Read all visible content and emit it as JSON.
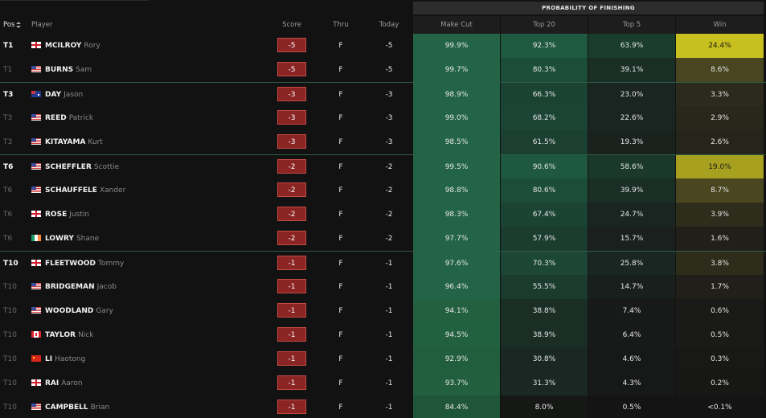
{
  "header": {
    "group_title": "PROBABILITY OF FINISHING",
    "columns": {
      "pos": "Pos",
      "player": "Player",
      "score": "Score",
      "thru": "Thru",
      "today": "Today",
      "make_cut": "Make Cut",
      "top20": "Top 20",
      "top5": "Top 5",
      "win": "Win"
    }
  },
  "colors": {
    "score_badge": "#8a2524",
    "tie_divider": "#2f5b48",
    "high_win": "#c8c01e"
  },
  "rows": [
    {
      "pos": "T1",
      "leader": true,
      "flag": "eng",
      "last": "MCILROY",
      "first": "Rory",
      "score": "-5",
      "thru": "F",
      "today": "-5",
      "make_cut": "99.9%",
      "top20": "92.3%",
      "top5": "63.9%",
      "win": "24.4%",
      "bg": [
        "#236447",
        "#1e5940",
        "#1a3d2e",
        "#c8c01e"
      ],
      "win_color": "#1a1a1a"
    },
    {
      "pos": "T1",
      "leader": false,
      "flag": "usa",
      "last": "BURNS",
      "first": "Sam",
      "score": "-5",
      "thru": "F",
      "today": "-5",
      "make_cut": "99.7%",
      "top20": "80.3%",
      "top5": "39.1%",
      "win": "8.6%",
      "bg": [
        "#236447",
        "#1c4d39",
        "#1a2e26",
        "#484520"
      ],
      "win_color": "#e6e6e6"
    },
    {
      "pos": "T3",
      "leader": true,
      "flag": "aus",
      "last": "DAY",
      "first": "Jason",
      "score": "-3",
      "thru": "F",
      "today": "-3",
      "make_cut": "98.9%",
      "top20": "66.3%",
      "top5": "23.0%",
      "win": "3.3%",
      "bg": [
        "#236447",
        "#1b4334",
        "#1a2420",
        "#2b2a1c"
      ],
      "win_color": "#e6e6e6"
    },
    {
      "pos": "T3",
      "leader": false,
      "flag": "usa",
      "last": "REED",
      "first": "Patrick",
      "score": "-3",
      "thru": "F",
      "today": "-3",
      "make_cut": "99.0%",
      "top20": "68.2%",
      "top5": "22.6%",
      "win": "2.9%",
      "bg": [
        "#236447",
        "#1b4435",
        "#1a2420",
        "#28271b"
      ],
      "win_color": "#e6e6e6"
    },
    {
      "pos": "T3",
      "leader": false,
      "flag": "usa",
      "last": "KITAYAMA",
      "first": "Kurt",
      "score": "-3",
      "thru": "F",
      "today": "-3",
      "make_cut": "98.5%",
      "top20": "61.5%",
      "top5": "19.3%",
      "win": "2.6%",
      "bg": [
        "#236447",
        "#1b3f31",
        "#1a221e",
        "#26251b"
      ],
      "win_color": "#e6e6e6"
    },
    {
      "pos": "T6",
      "leader": true,
      "flag": "usa",
      "last": "SCHEFFLER",
      "first": "Scottie",
      "score": "-2",
      "thru": "F",
      "today": "-2",
      "make_cut": "99.5%",
      "top20": "90.6%",
      "top5": "58.6%",
      "win": "19.0%",
      "bg": [
        "#236447",
        "#1e5840",
        "#1a392b",
        "#a7a11f"
      ],
      "win_color": "#1a1a1a"
    },
    {
      "pos": "T6",
      "leader": false,
      "flag": "usa",
      "last": "SCHAUFFELE",
      "first": "Xander",
      "score": "-2",
      "thru": "F",
      "today": "-2",
      "make_cut": "98.8%",
      "top20": "80.6%",
      "top5": "39.9%",
      "win": "8.7%",
      "bg": [
        "#236447",
        "#1c4d39",
        "#1a2e26",
        "#494620"
      ],
      "win_color": "#e6e6e6"
    },
    {
      "pos": "T6",
      "leader": false,
      "flag": "eng",
      "last": "ROSE",
      "first": "Justin",
      "score": "-2",
      "thru": "F",
      "today": "-2",
      "make_cut": "98.3%",
      "top20": "67.4%",
      "top5": "24.7%",
      "win": "3.9%",
      "bg": [
        "#236447",
        "#1b4334",
        "#1a2521",
        "#2e2d1c"
      ],
      "win_color": "#e6e6e6"
    },
    {
      "pos": "T6",
      "leader": false,
      "flag": "irl",
      "last": "LOWRY",
      "first": "Shane",
      "score": "-2",
      "thru": "F",
      "today": "-2",
      "make_cut": "97.7%",
      "top20": "57.9%",
      "top5": "15.7%",
      "win": "1.6%",
      "bg": [
        "#236447",
        "#1b3d30",
        "#19201d",
        "#201f19"
      ],
      "win_color": "#e6e6e6"
    },
    {
      "pos": "T10",
      "leader": true,
      "flag": "eng",
      "last": "FLEETWOOD",
      "first": "Tommy",
      "score": "-1",
      "thru": "F",
      "today": "-1",
      "make_cut": "97.6%",
      "top20": "70.3%",
      "top5": "25.8%",
      "win": "3.8%",
      "bg": [
        "#236447",
        "#1c4636",
        "#1a2621",
        "#2e2d1c"
      ],
      "win_color": "#e6e6e6"
    },
    {
      "pos": "T10",
      "leader": false,
      "flag": "usa",
      "last": "BRIDGEMAN",
      "first": "Jacob",
      "score": "-1",
      "thru": "F",
      "today": "-1",
      "make_cut": "96.4%",
      "top20": "55.5%",
      "top5": "14.7%",
      "win": "1.7%",
      "bg": [
        "#236447",
        "#1b3b2f",
        "#191f1c",
        "#211f19"
      ],
      "win_color": "#e6e6e6"
    },
    {
      "pos": "T10",
      "leader": false,
      "flag": "usa",
      "last": "WOODLAND",
      "first": "Gary",
      "score": "-1",
      "thru": "F",
      "today": "-1",
      "make_cut": "94.1%",
      "top20": "38.8%",
      "top5": "7.4%",
      "win": "0.6%",
      "bg": [
        "#22603f",
        "#1a2e26",
        "#181a19",
        "#1a1a18"
      ],
      "win_color": "#e6e6e6"
    },
    {
      "pos": "T10",
      "leader": false,
      "flag": "can",
      "last": "TAYLOR",
      "first": "Nick",
      "score": "-1",
      "thru": "F",
      "today": "-1",
      "make_cut": "94.5%",
      "top20": "38.9%",
      "top5": "6.4%",
      "win": "0.5%",
      "bg": [
        "#22613f",
        "#1a2e26",
        "#181a19",
        "#1a1a18"
      ],
      "win_color": "#e6e6e6"
    },
    {
      "pos": "T10",
      "leader": false,
      "flag": "chn",
      "last": "LI",
      "first": "Haotong",
      "score": "-1",
      "thru": "F",
      "today": "-1",
      "make_cut": "92.9%",
      "top20": "30.8%",
      "top5": "4.6%",
      "win": "0.3%",
      "bg": [
        "#215e3e",
        "#192822",
        "#171918",
        "#181817"
      ],
      "win_color": "#e6e6e6"
    },
    {
      "pos": "T10",
      "leader": false,
      "flag": "eng",
      "last": "RAI",
      "first": "Aaron",
      "score": "-1",
      "thru": "F",
      "today": "-1",
      "make_cut": "93.7%",
      "top20": "31.3%",
      "top5": "4.3%",
      "win": "0.2%",
      "bg": [
        "#215f3e",
        "#192822",
        "#171918",
        "#171716"
      ],
      "win_color": "#e6e6e6"
    },
    {
      "pos": "T10",
      "leader": false,
      "flag": "usa",
      "last": "CAMPBELL",
      "first": "Brian",
      "score": "-1",
      "thru": "F",
      "today": "-1",
      "make_cut": "84.4%",
      "top20": "8.0%",
      "top5": "0.5%",
      "win": "<0.1%",
      "bg": [
        "#1f5538",
        "#161816",
        "#141414",
        "#141414"
      ],
      "win_color": "#e6e6e6"
    }
  ]
}
